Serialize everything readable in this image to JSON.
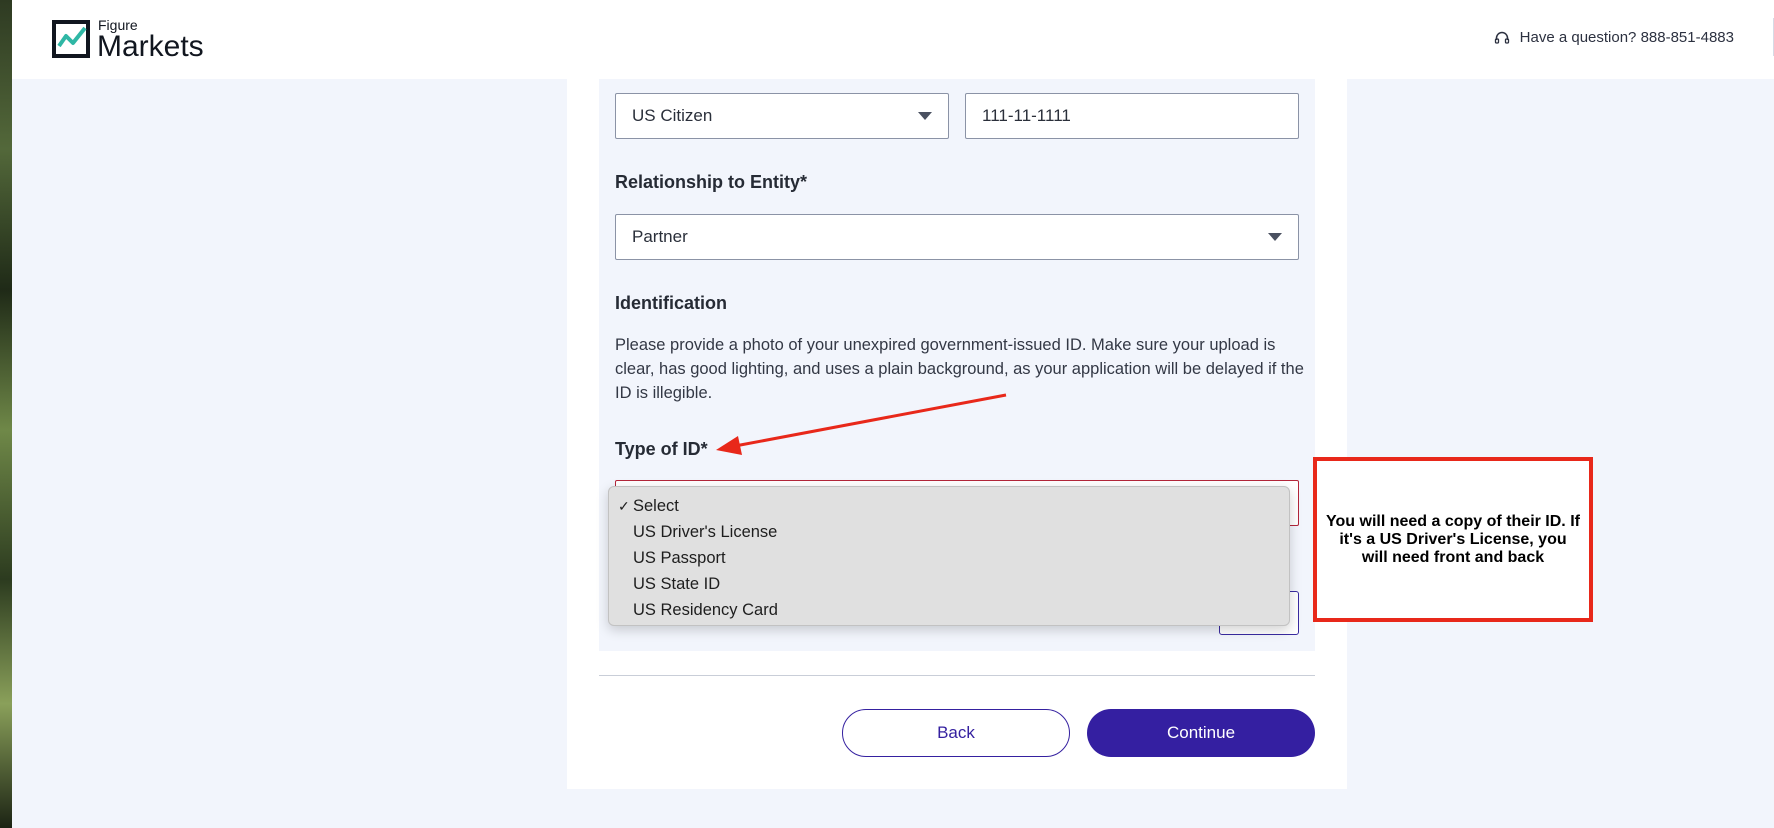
{
  "brand": {
    "small_text": "Figure",
    "large_text": "Markets"
  },
  "header": {
    "help_text": "Have a question? 888-851-4883"
  },
  "form": {
    "citizenship_value": "US Citizen",
    "ssn_value": "111-11-1111",
    "relationship_label": "Relationship to Entity*",
    "relationship_value": "Partner",
    "identification_heading": "Identification",
    "identification_text": "Please provide a photo of your unexpired government-issued ID. Make sure your upload is clear, has good lighting, and uses a plain background, as your application will be delayed if the ID is illegible.",
    "id_type_label": "Type of ID*",
    "id_type_options": [
      {
        "label": "Select",
        "selected": true
      },
      {
        "label": "US Driver's License",
        "selected": false
      },
      {
        "label": "US Passport",
        "selected": false
      },
      {
        "label": "US State ID",
        "selected": false
      },
      {
        "label": "US Residency Card",
        "selected": false
      }
    ]
  },
  "actions": {
    "back_label": "Back",
    "continue_label": "Continue"
  },
  "annotation": {
    "callout_text": "You will need a copy of their ID.  If it's a US Driver's License, you will need front and back"
  },
  "colors": {
    "accent": "#341fa1",
    "annotation_red": "#e8281a",
    "page_background": "#f2f5fc"
  },
  "icons": {
    "logo": "figure-markets-logo-icon",
    "help": "headset-icon",
    "select_caret": "caret-down-icon",
    "selected_check": "check-icon"
  }
}
